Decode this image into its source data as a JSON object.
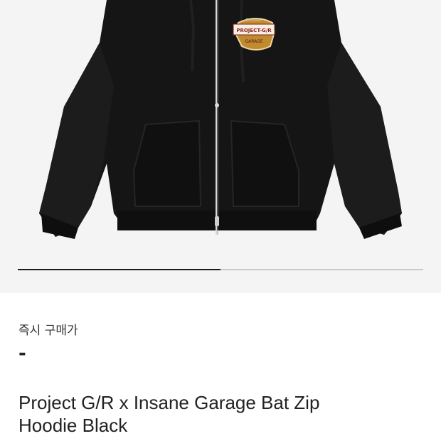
{
  "product": {
    "image_icon": "hoodie-image",
    "logo_text_top": "INSANE",
    "logo_text_mid": "PROJECT-G/R",
    "logo_text_bottom": "GARAGE",
    "carousel_progress": 0.5,
    "price_label": "즉시 구매가",
    "price_value": "-",
    "title_line1": "Project G/R x Insane Garage Bat Zip",
    "title_line2": "Hoodie Black"
  },
  "colors": {
    "hero_bg": "#f4f4f4",
    "hoodie": "#151515",
    "progress": "#1a1a1a",
    "track": "#c9c9c9"
  }
}
